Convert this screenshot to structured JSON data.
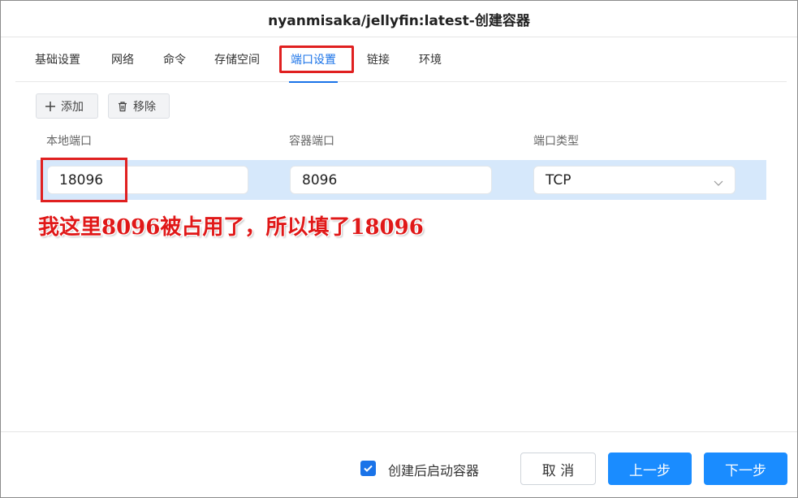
{
  "dialog": {
    "title": "nyanmisaka/jellyfin:latest-创建容器"
  },
  "tabs": [
    {
      "label": "基础设置"
    },
    {
      "label": "网络"
    },
    {
      "label": "命令"
    },
    {
      "label": "存储空间"
    },
    {
      "label": "端口设置",
      "active": true
    },
    {
      "label": "链接"
    },
    {
      "label": "环境"
    }
  ],
  "toolbar": {
    "add_label": "添加",
    "remove_label": "移除"
  },
  "table": {
    "headers": [
      "本地端口",
      "容器端口",
      "端口类型"
    ],
    "rows": [
      {
        "local_port": "18096",
        "container_port": "8096",
        "port_type": "TCP"
      }
    ]
  },
  "annotation": {
    "text": "我这里8096被占用了，所以填了18096"
  },
  "footer": {
    "start_after_create_label": "创建后启动容器",
    "start_after_create_checked": true,
    "cancel_label": "取 消",
    "prev_label": "上一步",
    "next_label": "下一步"
  },
  "colors": {
    "accent": "#1a73e8",
    "primary_button": "#1a8cff",
    "row_highlight": "#d6e8fb",
    "annotation_red": "#e01818"
  }
}
